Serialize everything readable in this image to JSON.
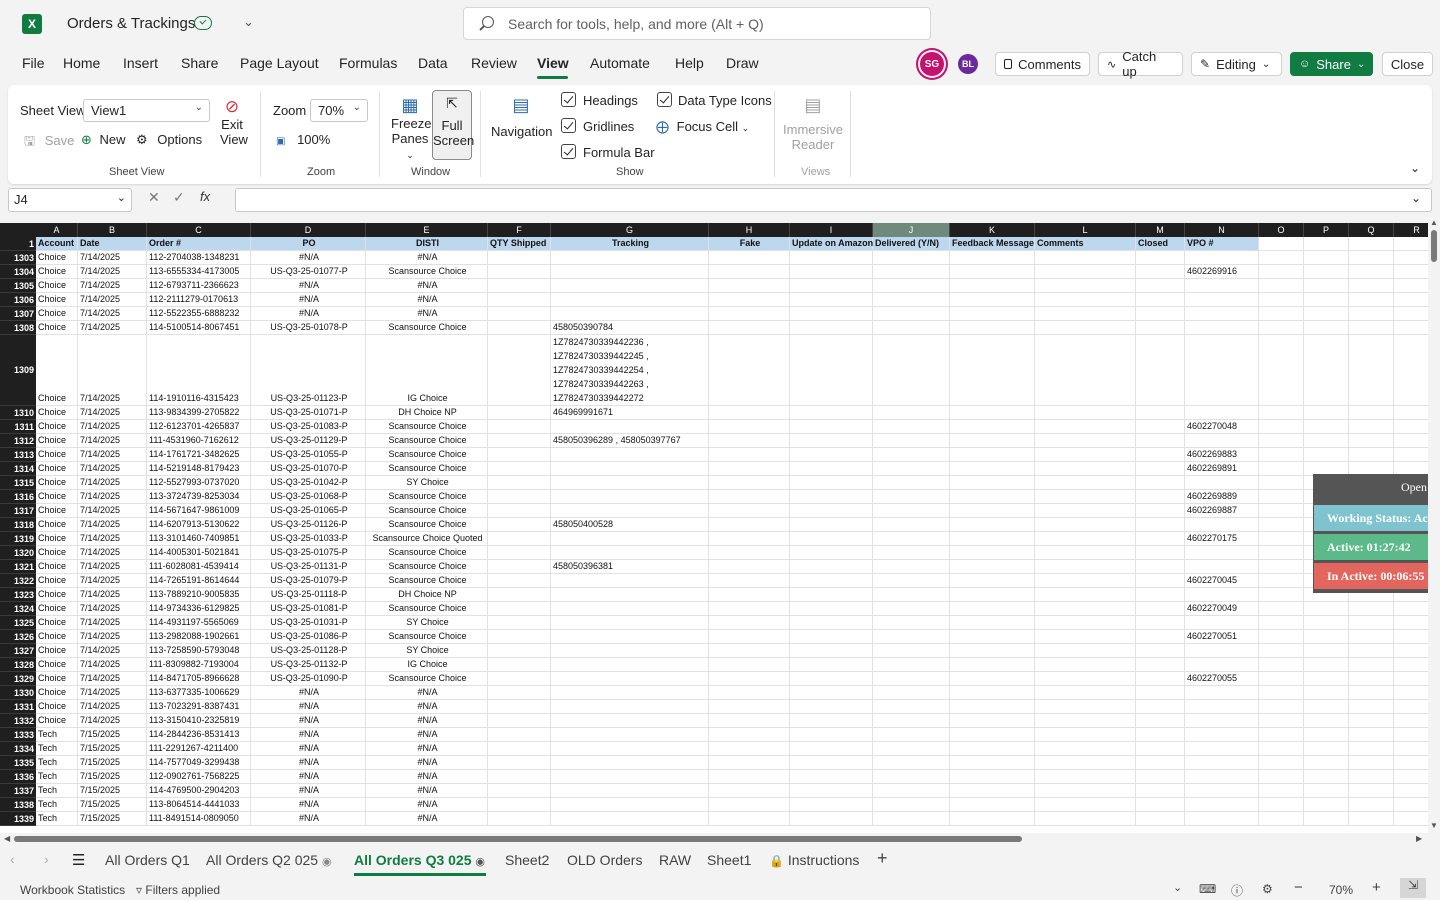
{
  "app": {
    "doc_title": "Orders & Trackings",
    "search_placeholder": "Search for tools, help, and more (Alt + Q)"
  },
  "menu": {
    "items": [
      "File",
      "Home",
      "Insert",
      "Share",
      "Page Layout",
      "Formulas",
      "Data",
      "Review",
      "View",
      "Automate",
      "Help",
      "Draw"
    ],
    "active": "View"
  },
  "collab": {
    "avatar1": "SG",
    "avatar2": "BL",
    "comments": "Comments",
    "catch_up": "Catch up",
    "editing": "Editing",
    "share": "Share",
    "close": "Close"
  },
  "ribbon": {
    "sheet_view_label": "Sheet View",
    "sheet_view_value": "View1",
    "save": "Save",
    "new": "New",
    "options": "Options",
    "exit_view": [
      "Exit",
      "View"
    ],
    "group_sheet_view": "Sheet View",
    "zoom_label": "Zoom",
    "zoom_value": "70%",
    "zoom_100": "100%",
    "group_zoom": "Zoom",
    "freeze_panes": [
      "Freeze",
      "Panes"
    ],
    "full_screen": [
      "Full",
      "Screen"
    ],
    "group_window": "Window",
    "navigation": "Navigation",
    "headings": "Headings",
    "gridlines": "Gridlines",
    "formula_bar": "Formula Bar",
    "data_type_icons": "Data Type Icons",
    "focus_cell": "Focus Cell",
    "group_show": "Show",
    "immersive_reader": [
      "Immersive",
      "Reader"
    ],
    "group_views": "Views"
  },
  "formula_bar": {
    "cell_ref": "J4",
    "value": ""
  },
  "columns": [
    "A",
    "B",
    "C",
    "D",
    "E",
    "F",
    "G",
    "H",
    "I",
    "J",
    "K",
    "L",
    "M",
    "N",
    "O",
    "P",
    "Q",
    "R"
  ],
  "header_row": {
    "num": "1",
    "cells": [
      "Account",
      "Date",
      "Order #",
      "PO",
      "DISTI",
      "QTY Shipped",
      "Tracking",
      "Fake",
      "Update on Amazon",
      "Delivered (Y/N)",
      "Feedback Message",
      "Comments",
      "Closed",
      "VPO #",
      "",
      "",
      "",
      ""
    ]
  },
  "rows": [
    {
      "num": "1303",
      "cells": [
        "Choice",
        "7/14/2025",
        "112-2704038-1348231",
        "#N/A",
        "#N/A",
        "",
        "",
        "",
        "",
        "",
        "",
        "",
        "",
        ""
      ]
    },
    {
      "num": "1304",
      "cells": [
        "Choice",
        "7/14/2025",
        "113-6555334-4173005",
        "US-Q3-25-01077-P",
        "Scansource Choice",
        "",
        "",
        "",
        "",
        "",
        "",
        "",
        "",
        "4602269916"
      ]
    },
    {
      "num": "1305",
      "cells": [
        "Choice",
        "7/14/2025",
        "112-6793711-2366623",
        "#N/A",
        "#N/A",
        "",
        "",
        "",
        "",
        "",
        "",
        "",
        "",
        ""
      ]
    },
    {
      "num": "1306",
      "cells": [
        "Choice",
        "7/14/2025",
        "112-2111279-0170613",
        "#N/A",
        "#N/A",
        "",
        "",
        "",
        "",
        "",
        "",
        "",
        "",
        ""
      ]
    },
    {
      "num": "1307",
      "cells": [
        "Choice",
        "7/14/2025",
        "112-5522355-6888232",
        "#N/A",
        "#N/A",
        "",
        "",
        "",
        "",
        "",
        "",
        "",
        "",
        ""
      ]
    },
    {
      "num": "1308",
      "cells": [
        "Choice",
        "7/14/2025",
        "114-5100514-8067451",
        "US-Q3-25-01078-P",
        "Scansource Choice",
        "",
        "458050390784",
        "",
        "",
        "",
        "",
        "",
        "",
        ""
      ]
    },
    {
      "num": "1309",
      "tall": true,
      "tracking_lines": [
        "1Z7824730339442236 ,",
        "1Z7824730339442245 ,",
        "1Z7824730339442254 ,",
        "1Z7824730339442263 ,",
        "1Z7824730339442272"
      ],
      "cells": [
        "Choice",
        "7/14/2025",
        "114-1910116-4315423",
        "US-Q3-25-01123-P",
        "IG Choice",
        "",
        "",
        "",
        "",
        "",
        "",
        "",
        "",
        ""
      ]
    },
    {
      "num": "1310",
      "cells": [
        "Choice",
        "7/14/2025",
        "113-9834399-2705822",
        "US-Q3-25-01071-P",
        "DH Choice NP",
        "",
        "464969991671",
        "",
        "",
        "",
        "",
        "",
        "",
        ""
      ]
    },
    {
      "num": "1311",
      "cells": [
        "Choice",
        "7/14/2025",
        "112-6123701-4265837",
        "US-Q3-25-01083-P",
        "Scansource Choice",
        "",
        "",
        "",
        "",
        "",
        "",
        "",
        "",
        "4602270048"
      ]
    },
    {
      "num": "1312",
      "cells": [
        "Choice",
        "7/14/2025",
        "111-4531960-7162612",
        "US-Q3-25-01129-P",
        "Scansource Choice",
        "",
        "458050396289 , 458050397767",
        "",
        "",
        "",
        "",
        "",
        "",
        ""
      ]
    },
    {
      "num": "1313",
      "cells": [
        "Choice",
        "7/14/2025",
        "114-1761721-3482625",
        "US-Q3-25-01055-P",
        "Scansource Choice",
        "",
        "",
        "",
        "",
        "",
        "",
        "",
        "",
        "4602269883"
      ]
    },
    {
      "num": "1314",
      "cells": [
        "Choice",
        "7/14/2025",
        "114-5219148-8179423",
        "US-Q3-25-01070-P",
        "Scansource Choice",
        "",
        "",
        "",
        "",
        "",
        "",
        "",
        "",
        "4602269891"
      ]
    },
    {
      "num": "1315",
      "cells": [
        "Choice",
        "7/14/2025",
        "112-5527993-0737020",
        "US-Q3-25-01042-P",
        "SY Choice",
        "",
        "",
        "",
        "",
        "",
        "",
        "",
        "",
        ""
      ]
    },
    {
      "num": "1316",
      "cells": [
        "Choice",
        "7/14/2025",
        "113-3724739-8253034",
        "US-Q3-25-01068-P",
        "Scansource Choice",
        "",
        "",
        "",
        "",
        "",
        "",
        "",
        "",
        "4602269889"
      ]
    },
    {
      "num": "1317",
      "cells": [
        "Choice",
        "7/14/2025",
        "114-5671647-9861009",
        "US-Q3-25-01065-P",
        "Scansource Choice",
        "",
        "",
        "",
        "",
        "",
        "",
        "",
        "",
        "4602269887"
      ]
    },
    {
      "num": "1318",
      "cells": [
        "Choice",
        "7/14/2025",
        "114-6207913-5130622",
        "US-Q3-25-01126-P",
        "Scansource Choice",
        "",
        "458050400528",
        "",
        "",
        "",
        "",
        "",
        "",
        ""
      ]
    },
    {
      "num": "1319",
      "cells": [
        "Choice",
        "7/14/2025",
        "113-3101460-7409851",
        "US-Q3-25-01033-P",
        "Scansource Choice Quoted",
        "",
        "",
        "",
        "",
        "",
        "",
        "",
        "",
        "4602270175"
      ]
    },
    {
      "num": "1320",
      "cells": [
        "Choice",
        "7/14/2025",
        "114-4005301-5021841",
        "US-Q3-25-01075-P",
        "Scansource Choice",
        "",
        "",
        "",
        "",
        "",
        "",
        "",
        "",
        ""
      ]
    },
    {
      "num": "1321",
      "cells": [
        "Choice",
        "7/14/2025",
        "111-6028081-4539414",
        "US-Q3-25-01131-P",
        "Scansource Choice",
        "",
        "458050396381",
        "",
        "",
        "",
        "",
        "",
        "",
        ""
      ]
    },
    {
      "num": "1322",
      "cells": [
        "Choice",
        "7/14/2025",
        "114-7265191-8614644",
        "US-Q3-25-01079-P",
        "Scansource Choice",
        "",
        "",
        "",
        "",
        "",
        "",
        "",
        "",
        "4602270045"
      ]
    },
    {
      "num": "1323",
      "cells": [
        "Choice",
        "7/14/2025",
        "113-7889210-9005835",
        "US-Q3-25-01118-P",
        "DH Choice NP",
        "",
        "",
        "",
        "",
        "",
        "",
        "",
        "",
        ""
      ]
    },
    {
      "num": "1324",
      "cells": [
        "Choice",
        "7/14/2025",
        "114-9734336-6129825",
        "US-Q3-25-01081-P",
        "Scansource Choice",
        "",
        "",
        "",
        "",
        "",
        "",
        "",
        "",
        "4602270049"
      ]
    },
    {
      "num": "1325",
      "cells": [
        "Choice",
        "7/14/2025",
        "114-4931197-5565069",
        "US-Q3-25-01031-P",
        "SY Choice",
        "",
        "",
        "",
        "",
        "",
        "",
        "",
        "",
        ""
      ]
    },
    {
      "num": "1326",
      "cells": [
        "Choice",
        "7/14/2025",
        "113-2982088-1902661",
        "US-Q3-25-01086-P",
        "Scansource Choice",
        "",
        "",
        "",
        "",
        "",
        "",
        "",
        "",
        "4602270051"
      ]
    },
    {
      "num": "1327",
      "cells": [
        "Choice",
        "7/14/2025",
        "113-7258590-5793048",
        "US-Q3-25-01128-P",
        "SY Choice",
        "",
        "",
        "",
        "",
        "",
        "",
        "",
        "",
        ""
      ]
    },
    {
      "num": "1328",
      "cells": [
        "Choice",
        "7/14/2025",
        "111-8309882-7193004",
        "US-Q3-25-01132-P",
        "IG Choice",
        "",
        "",
        "",
        "",
        "",
        "",
        "",
        "",
        ""
      ]
    },
    {
      "num": "1329",
      "cells": [
        "Choice",
        "7/14/2025",
        "114-8471705-8966628",
        "US-Q3-25-01090-P",
        "Scansource Choice",
        "",
        "",
        "",
        "",
        "",
        "",
        "",
        "",
        "4602270055"
      ]
    },
    {
      "num": "1330",
      "cells": [
        "Choice",
        "7/14/2025",
        "113-6377335-1006629",
        "#N/A",
        "#N/A",
        "",
        "",
        "",
        "",
        "",
        "",
        "",
        "",
        ""
      ]
    },
    {
      "num": "1331",
      "cells": [
        "Choice",
        "7/14/2025",
        "113-7023291-8387431",
        "#N/A",
        "#N/A",
        "",
        "",
        "",
        "",
        "",
        "",
        "",
        "",
        ""
      ]
    },
    {
      "num": "1332",
      "cells": [
        "Choice",
        "7/14/2025",
        "113-3150410-2325819",
        "#N/A",
        "#N/A",
        "",
        "",
        "",
        "",
        "",
        "",
        "",
        "",
        ""
      ]
    },
    {
      "num": "1333",
      "cells": [
        "Tech",
        "7/15/2025",
        "114-2844236-8531413",
        "#N/A",
        "#N/A",
        "",
        "",
        "",
        "",
        "",
        "",
        "",
        "",
        ""
      ]
    },
    {
      "num": "1334",
      "cells": [
        "Tech",
        "7/15/2025",
        "111-2291267-4211400",
        "#N/A",
        "#N/A",
        "",
        "",
        "",
        "",
        "",
        "",
        "",
        "",
        ""
      ]
    },
    {
      "num": "1335",
      "cells": [
        "Tech",
        "7/15/2025",
        "114-7577049-3299438",
        "#N/A",
        "#N/A",
        "",
        "",
        "",
        "",
        "",
        "",
        "",
        "",
        ""
      ]
    },
    {
      "num": "1336",
      "cells": [
        "Tech",
        "7/15/2025",
        "112-0902761-7568225",
        "#N/A",
        "#N/A",
        "",
        "",
        "",
        "",
        "",
        "",
        "",
        "",
        ""
      ]
    },
    {
      "num": "1337",
      "cells": [
        "Tech",
        "7/15/2025",
        "114-4769500-2904203",
        "#N/A",
        "#N/A",
        "",
        "",
        "",
        "",
        "",
        "",
        "",
        "",
        ""
      ]
    },
    {
      "num": "1338",
      "cells": [
        "Tech",
        "7/15/2025",
        "113-8064514-4441033",
        "#N/A",
        "#N/A",
        "",
        "",
        "",
        "",
        "",
        "",
        "",
        "",
        ""
      ]
    },
    {
      "num": "1339",
      "cells": [
        "Tech",
        "7/15/2025",
        "111-8491514-0809050",
        "#N/A",
        "#N/A",
        "",
        "",
        "",
        "",
        "",
        "",
        "",
        "",
        ""
      ]
    }
  ],
  "widget": {
    "open_label": "Open A",
    "working_status": "Working Status: Acti",
    "active": "Active: 01:27:42",
    "inactive": "In Active: 00:06:55",
    "colors": {
      "status": "#7fc3cf",
      "active": "#5bb98a",
      "inactive": "#e2665e"
    }
  },
  "sheet_tabs": {
    "items": [
      "All Orders Q1",
      "All Orders Q2 025",
      "All Orders Q3 025",
      "Sheet2",
      "OLD Orders",
      "RAW",
      "Sheet1",
      "Instructions"
    ],
    "active": "All Orders Q3 025"
  },
  "status_bar": {
    "workbook_statistics": "Workbook Statistics",
    "filters": "Filters applied",
    "zoom": "70%"
  },
  "colors": {
    "accent": "#107c41",
    "header_fill": "#bdd7ee"
  }
}
